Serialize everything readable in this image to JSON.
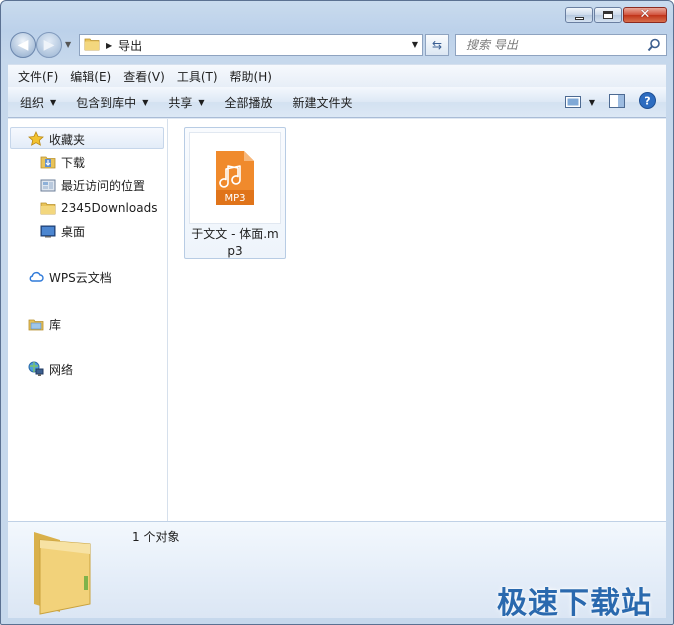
{
  "window": {
    "address_path": "导出",
    "search_placeholder": "搜索 导出"
  },
  "menubar": {
    "file": "文件(F)",
    "edit": "编辑(E)",
    "view": "查看(V)",
    "tools": "工具(T)",
    "help": "帮助(H)"
  },
  "commandbar": {
    "organize": "组织",
    "include_in_library": "包含到库中",
    "share": "共享",
    "play_all": "全部播放",
    "new_folder": "新建文件夹"
  },
  "navpane": {
    "favorites": "收藏夹",
    "downloads": "下载",
    "recent_places": "最近访问的位置",
    "downloads_2345": "2345Downloads",
    "desktop": "桌面",
    "wps_cloud": "WPS云文档",
    "libraries": "库",
    "network": "网络"
  },
  "files": [
    {
      "name": "于文文 - 体面.mp3",
      "badge": "MP3"
    }
  ],
  "details": {
    "count": "1 个对象"
  },
  "watermark": "极速下载站",
  "colors": {
    "mp3_orange": "#f08a2c",
    "folder_yellow": "#e8c35a",
    "accent_blue": "#1b5fa8"
  }
}
